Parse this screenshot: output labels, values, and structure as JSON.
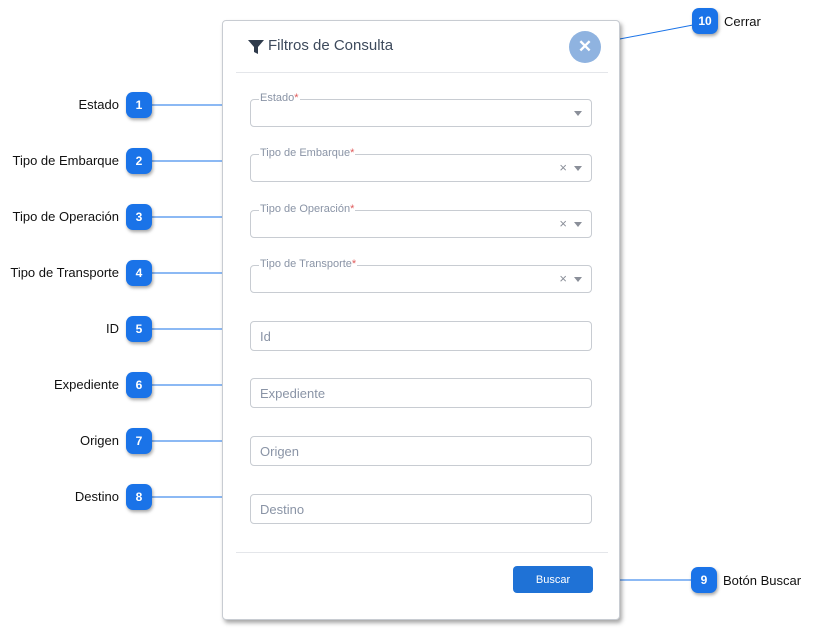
{
  "modal": {
    "title": "Filtros de Consulta",
    "close_symbol": "✕",
    "icon": "filter-icon",
    "close_icon": "close-icon"
  },
  "fields": {
    "estado": {
      "label": "Estado",
      "required": "*"
    },
    "tipo_embarque": {
      "label": "Tipo de Embarque",
      "required": "*",
      "clear": "×"
    },
    "tipo_operacion": {
      "label": "Tipo de Operación",
      "required": "*",
      "clear": "×"
    },
    "tipo_transporte": {
      "label": "Tipo de Transporte",
      "required": "*",
      "clear": "×"
    },
    "id": {
      "placeholder": "Id",
      "value": ""
    },
    "expediente": {
      "placeholder": "Expediente",
      "value": ""
    },
    "origen": {
      "placeholder": "Origen",
      "value": ""
    },
    "destino": {
      "placeholder": "Destino",
      "value": ""
    }
  },
  "buttons": {
    "buscar": "Buscar"
  },
  "annotations": {
    "a1": {
      "num": "1",
      "text": "Estado"
    },
    "a2": {
      "num": "2",
      "text": "Tipo de Embarque"
    },
    "a3": {
      "num": "3",
      "text": "Tipo de Operación"
    },
    "a4": {
      "num": "4",
      "text": "Tipo de Transporte"
    },
    "a5": {
      "num": "5",
      "text": "ID"
    },
    "a6": {
      "num": "6",
      "text": "Expediente"
    },
    "a7": {
      "num": "7",
      "text": "Origen"
    },
    "a8": {
      "num": "8",
      "text": "Destino"
    },
    "a9": {
      "num": "9",
      "text": "Botón Buscar"
    },
    "a10": {
      "num": "10",
      "text": "Cerrar"
    }
  },
  "colors": {
    "accent": "#1f72d6",
    "badge": "#1a73e8",
    "close_button": "#8fb3e0",
    "required": "#e05b5b",
    "leader_line": "#1a73e8"
  }
}
